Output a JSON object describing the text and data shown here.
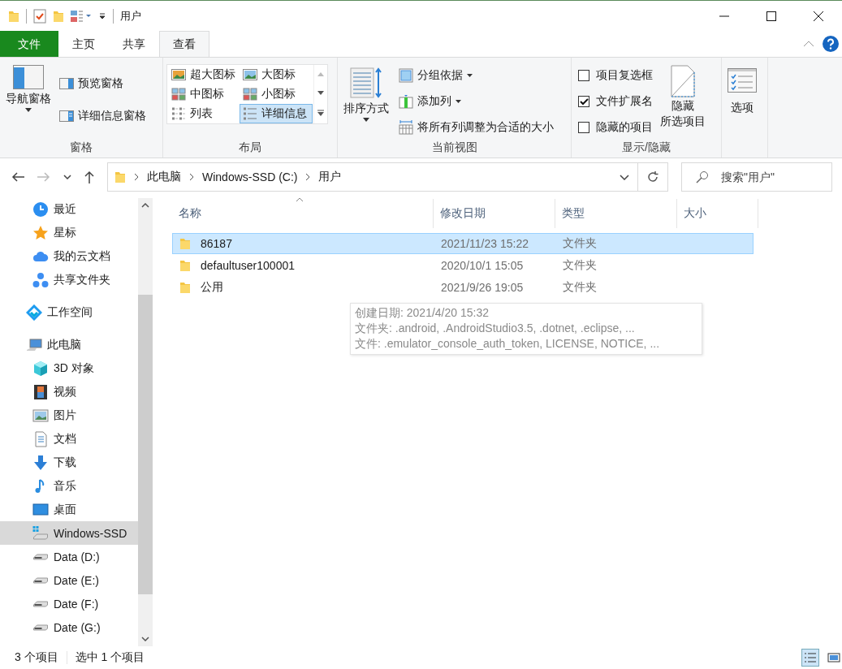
{
  "window": {
    "title": "用户"
  },
  "tabs": [
    {
      "label": "文件",
      "kind": "file",
      "selected": false
    },
    {
      "label": "主页",
      "kind": "tab",
      "selected": false
    },
    {
      "label": "共享",
      "kind": "tab",
      "selected": false
    },
    {
      "label": "查看",
      "kind": "tab",
      "selected": true
    }
  ],
  "ribbon": {
    "panes": {
      "label": "窗格",
      "navigation_pane": "导航窗格",
      "preview_pane": "预览窗格",
      "details_pane": "详细信息窗格"
    },
    "layout": {
      "label": "布局",
      "views": [
        {
          "label": "超大图标",
          "kind": "xl",
          "selected": false
        },
        {
          "label": "大图标",
          "kind": "large",
          "selected": false
        },
        {
          "label": "中图标",
          "kind": "medium",
          "selected": false
        },
        {
          "label": "小图标",
          "kind": "small",
          "selected": false
        },
        {
          "label": "列表",
          "kind": "list",
          "selected": false
        },
        {
          "label": "详细信息",
          "kind": "details",
          "selected": true
        }
      ]
    },
    "current_view": {
      "label": "当前视图",
      "sort_by": "排序方式",
      "group_by": "分组依据",
      "add_columns": "添加列",
      "size_all_columns": "将所有列调整为合适的大小"
    },
    "show_hide": {
      "label": "显示/隐藏",
      "options": [
        {
          "label": "项目复选框",
          "checked": false
        },
        {
          "label": "文件扩展名",
          "checked": true
        },
        {
          "label": "隐藏的项目",
          "checked": false
        }
      ],
      "hide_selected": [
        "隐藏",
        "所选项目"
      ]
    },
    "options": "选项"
  },
  "address": {
    "breadcrumbs": [
      "此电脑",
      "Windows-SSD (C:)",
      "用户"
    ]
  },
  "search": {
    "placeholder": "搜索\"用户\""
  },
  "sidebar": {
    "sections": [
      {
        "items": [
          {
            "label": "最近",
            "kind": "clock",
            "selected": false
          },
          {
            "label": "星标",
            "kind": "star",
            "selected": false
          },
          {
            "label": "我的云文档",
            "kind": "cloud",
            "selected": false
          },
          {
            "label": "共享文件夹",
            "kind": "share",
            "selected": false
          }
        ]
      },
      {
        "items": [
          {
            "label": "工作空间",
            "kind": "workspace",
            "selected": false
          }
        ]
      },
      {
        "items": [
          {
            "label": "此电脑",
            "kind": "pc",
            "selected": false,
            "children": [
              {
                "label": "3D 对象",
                "kind": "cube",
                "selected": false
              },
              {
                "label": "视频",
                "kind": "film",
                "selected": false
              },
              {
                "label": "图片",
                "kind": "image",
                "selected": false
              },
              {
                "label": "文档",
                "kind": "doc",
                "selected": false
              },
              {
                "label": "下载",
                "kind": "download",
                "selected": false
              },
              {
                "label": "音乐",
                "kind": "music",
                "selected": false
              },
              {
                "label": "桌面",
                "kind": "desktop",
                "selected": false
              },
              {
                "label": "Windows-SSD",
                "kind": "windrive",
                "selected": true
              },
              {
                "label": "Data (D:)",
                "kind": "drive",
                "selected": false
              },
              {
                "label": "Date (E:)",
                "kind": "drive",
                "selected": false
              },
              {
                "label": "Date (F:)",
                "kind": "drive",
                "selected": false
              },
              {
                "label": "Date (G:)",
                "kind": "drive",
                "selected": false
              }
            ]
          }
        ]
      }
    ]
  },
  "table": {
    "columns": [
      "名称",
      "修改日期",
      "类型",
      "大小"
    ],
    "rows": [
      {
        "name": "86187",
        "modified": "2021/11/23 15:22",
        "type": "文件夹",
        "selected": true
      },
      {
        "name": "defaultuser100001",
        "modified": "2020/10/1 15:05",
        "type": "文件夹",
        "selected": false
      },
      {
        "name": "公用",
        "modified": "2021/9/26 19:05",
        "type": "文件夹",
        "selected": false
      }
    ]
  },
  "tooltip": [
    "创建日期: 2021/4/20 15:32",
    "文件夹: .android, .AndroidStudio3.5, .dotnet, .eclipse, ...",
    "文件: .emulator_console_auth_token, LICENSE, NOTICE, ..."
  ],
  "status_bar": {
    "item_count": "3 个项目",
    "selection": "选中 1 个项目"
  }
}
